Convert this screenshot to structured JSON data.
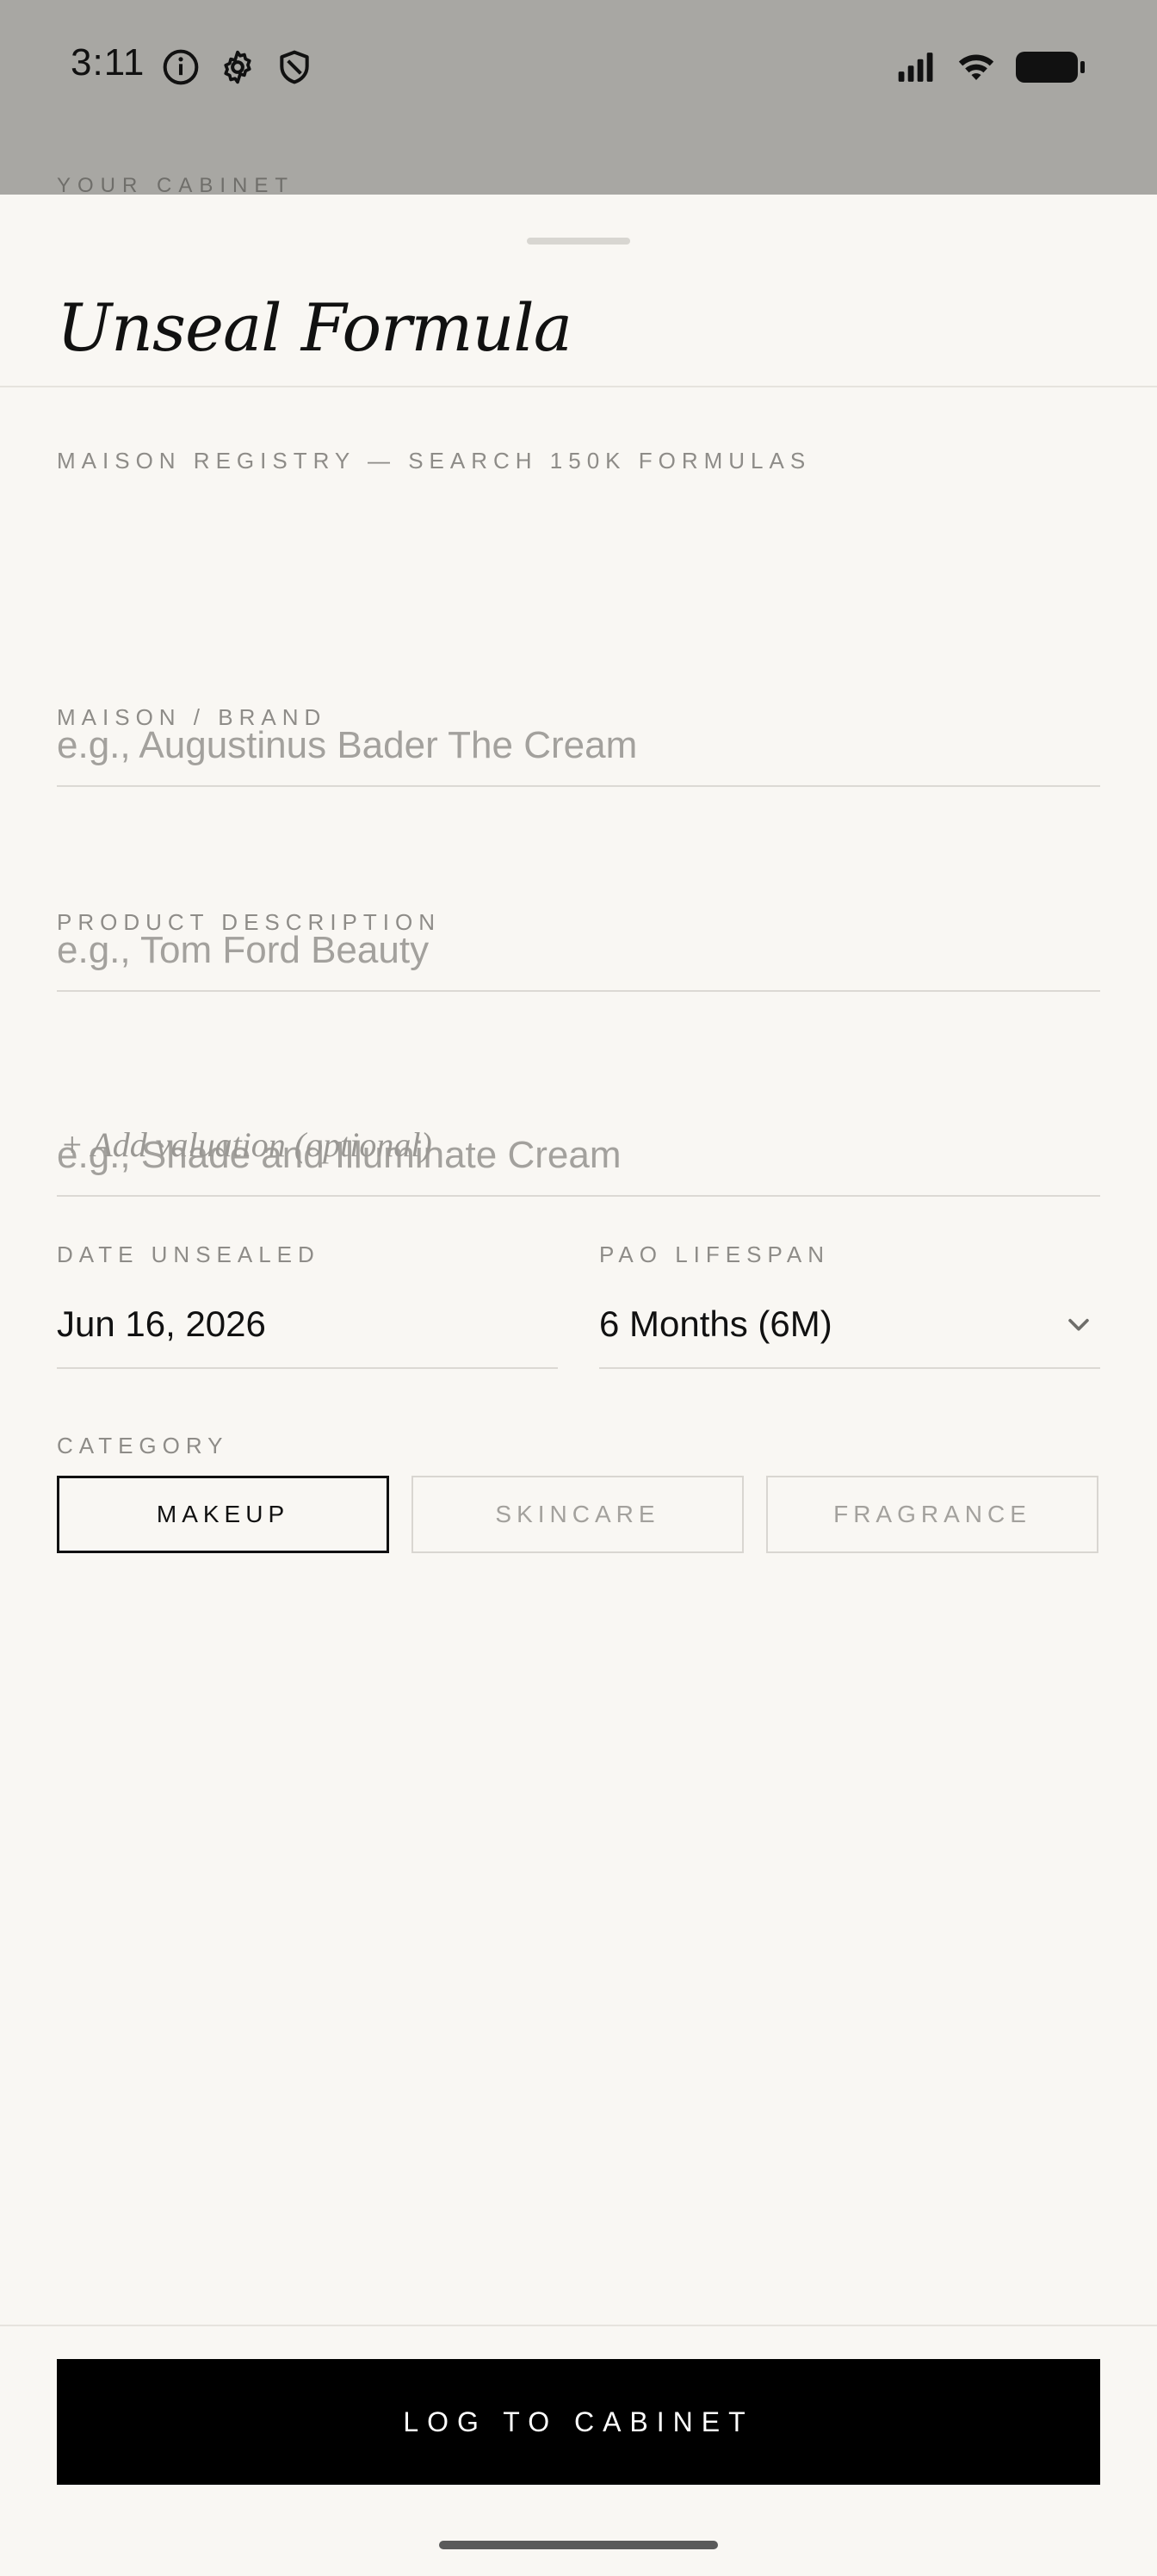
{
  "status_bar": {
    "time": "3:11",
    "icons": [
      "info-icon",
      "gear-icon",
      "shield-icon",
      "signal-icon",
      "wifi-icon",
      "battery-icon"
    ]
  },
  "background": {
    "section_label": "YOUR CABINET"
  },
  "sheet": {
    "title": "Unseal Formula",
    "registry": {
      "label": "MAISON REGISTRY — SEARCH 150K FORMULAS",
      "placeholder": "e.g., Augustinus Bader The Cream",
      "value": ""
    },
    "brand": {
      "label": "MAISON / BRAND",
      "placeholder": "e.g., Tom Ford Beauty",
      "value": ""
    },
    "description": {
      "label": "PRODUCT DESCRIPTION",
      "placeholder": "e.g., Shade and Illuminate Cream",
      "value": ""
    },
    "add_valuation": "+ Add valuation (optional)",
    "date_unsealed": {
      "label": "DATE UNSEALED",
      "value": "Jun 16, 2026"
    },
    "pao_lifespan": {
      "label": "PAO LIFESPAN",
      "value": "6 Months (6M)"
    },
    "category": {
      "label": "CATEGORY",
      "options": [
        "MAKEUP",
        "SKINCARE",
        "FRAGRANCE"
      ],
      "selected": "MAKEUP"
    },
    "submit_label": "LOG TO CABINET"
  },
  "colors": {
    "sheet_bg": "#f9f7f3",
    "overlay_bg": "#a8a7a3",
    "accent": "#000000",
    "placeholder": "#a3a19d",
    "label": "#8e8c88"
  }
}
